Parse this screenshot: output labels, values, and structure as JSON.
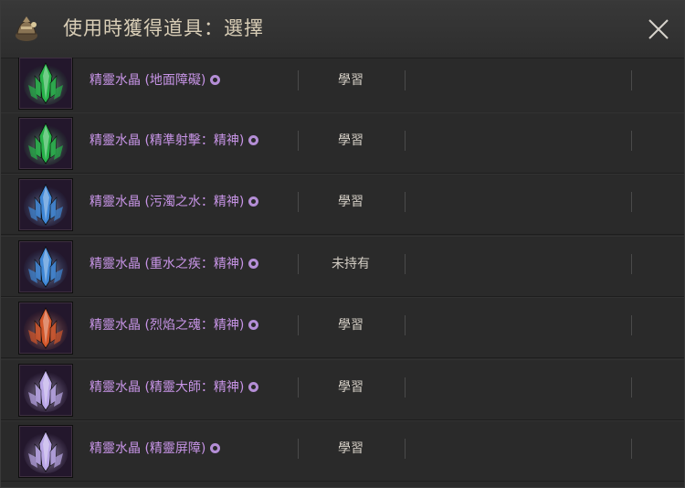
{
  "window": {
    "title": "使用時獲得道具：選擇"
  },
  "items": [
    {
      "name": "精靈水晶 (地面障礙)",
      "status": "學習",
      "crystal_color": "#27b34a"
    },
    {
      "name": "精靈水晶 (精準射擊：精神)",
      "status": "學習",
      "crystal_color": "#27b34a"
    },
    {
      "name": "精靈水晶 (污濁之水：精神)",
      "status": "學習",
      "crystal_color": "#3f87d6"
    },
    {
      "name": "精靈水晶 (重水之疾：精神)",
      "status": "未持有",
      "crystal_color": "#3f87d6"
    },
    {
      "name": "精靈水晶 (烈焰之魂：精神)",
      "status": "學習",
      "crystal_color": "#d2562a"
    },
    {
      "name": "精靈水晶 (精靈大師：精神)",
      "status": "學習",
      "crystal_color": "#b9a6e6"
    },
    {
      "name": "精靈水晶 (精靈屏障)",
      "status": "學習",
      "crystal_color": "#b9a6e6"
    }
  ],
  "colors": {
    "item_name": "#c794e6",
    "title": "#d8cdb6",
    "status": "#d3cdc4",
    "background": "#2a2a2a"
  },
  "icons": {
    "header": "item-bag-icon",
    "close": "close-icon",
    "item": "spirit-crystal-icon",
    "bound": "bound-item-icon"
  }
}
